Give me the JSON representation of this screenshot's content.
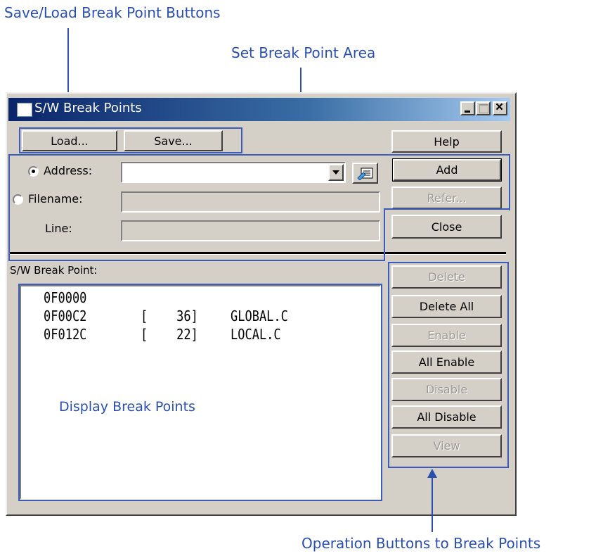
{
  "annotations": {
    "save_load": "Save/Load Break Point Buttons",
    "set_area": "Set Break Point Area",
    "display": "Display Break Points",
    "operations": "Operation Buttons to Break Points"
  },
  "window": {
    "title": "S/W Break Points",
    "minimize_glyph": "_",
    "maximize_glyph": "□",
    "close_glyph": "×"
  },
  "buttons": {
    "load": "Load...",
    "save": "Save...",
    "help": "Help",
    "add": "Add",
    "refer": "Refer...",
    "close": "Close"
  },
  "form": {
    "address_label": "Address:",
    "filename_label": "Filename:",
    "line_label": "Line:",
    "address_value": "",
    "filename_value": "",
    "line_value": "",
    "selected_mode": "Address"
  },
  "list": {
    "label": "S/W Break Point:",
    "rows": [
      {
        "address": "0F0000",
        "line": "",
        "file": ""
      },
      {
        "address": "0F00C2",
        "line": "[    36]",
        "file": "GLOBAL.C"
      },
      {
        "address": "0F012C",
        "line": "[    22]",
        "file": "LOCAL.C"
      }
    ]
  },
  "operations": {
    "delete": "Delete",
    "delete_all": "Delete All",
    "enable": "Enable",
    "all_enable": "All Enable",
    "disable": "Disable",
    "all_disable": "All Disable",
    "view": "View"
  },
  "icons": {
    "dropdown": "chevron-down-icon",
    "browse": "browse-source-icon"
  },
  "colors": {
    "annotation_blue": "#2a4fb0",
    "title_bar": "#0a246a",
    "face": "#d4d0c8"
  }
}
